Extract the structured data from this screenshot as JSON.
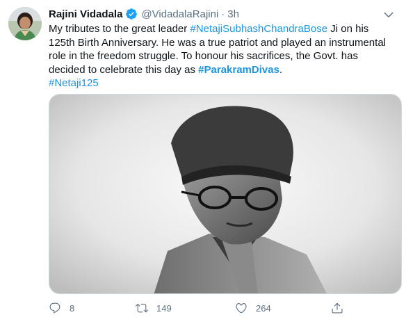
{
  "author": {
    "name": "Rajini Vidadala",
    "handle": "@VidadalaRajini",
    "separator": "·",
    "time": "3h"
  },
  "tweet": {
    "text_1": "My tributes to the great leader ",
    "hashtag_1": "#NetajiSubhashChandraBose",
    "text_2": " Ji on his 125th Birth Anniversary. He was a true patriot and played an instrumental role in the freedom struggle. To honour his sacrifices, the Govt. has decided to celebrate this day as ",
    "hashtag_2": "#ParakramDivas",
    "text_3": ".",
    "hashtag_3": "#Netaji125"
  },
  "actions": {
    "reply_count": "8",
    "retweet_count": "149",
    "like_count": "264"
  },
  "colors": {
    "link": "#1b95e0",
    "muted": "#5b7083",
    "verified": "#1da1f2"
  }
}
